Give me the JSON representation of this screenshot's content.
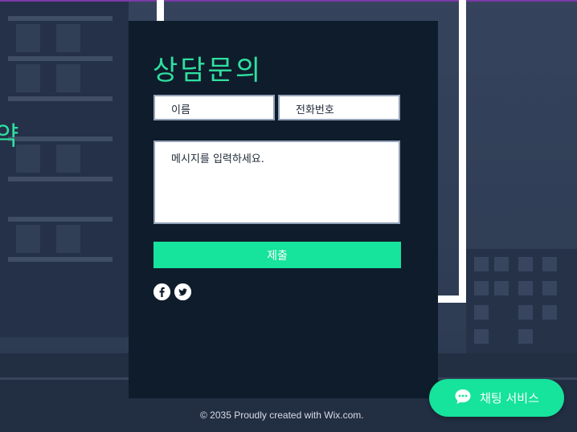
{
  "form": {
    "title": "상담문의",
    "name_placeholder": "이름",
    "phone_placeholder": "전화번호",
    "message_placeholder": "메시지를 입력하세요.",
    "submit_label": "제출"
  },
  "side_text": "약",
  "social": {
    "icons": [
      "facebook-icon",
      "twitter-icon"
    ]
  },
  "footer": {
    "text": "© 2035 Proudly created with Wix.com."
  },
  "chat": {
    "label": "채팅 서비스",
    "icon": "chat-bubble-icon"
  },
  "colors": {
    "accent": "#16e39c",
    "title": "#2fe0a0",
    "panel": "#0f1c2b",
    "frame": "#ffffff"
  }
}
